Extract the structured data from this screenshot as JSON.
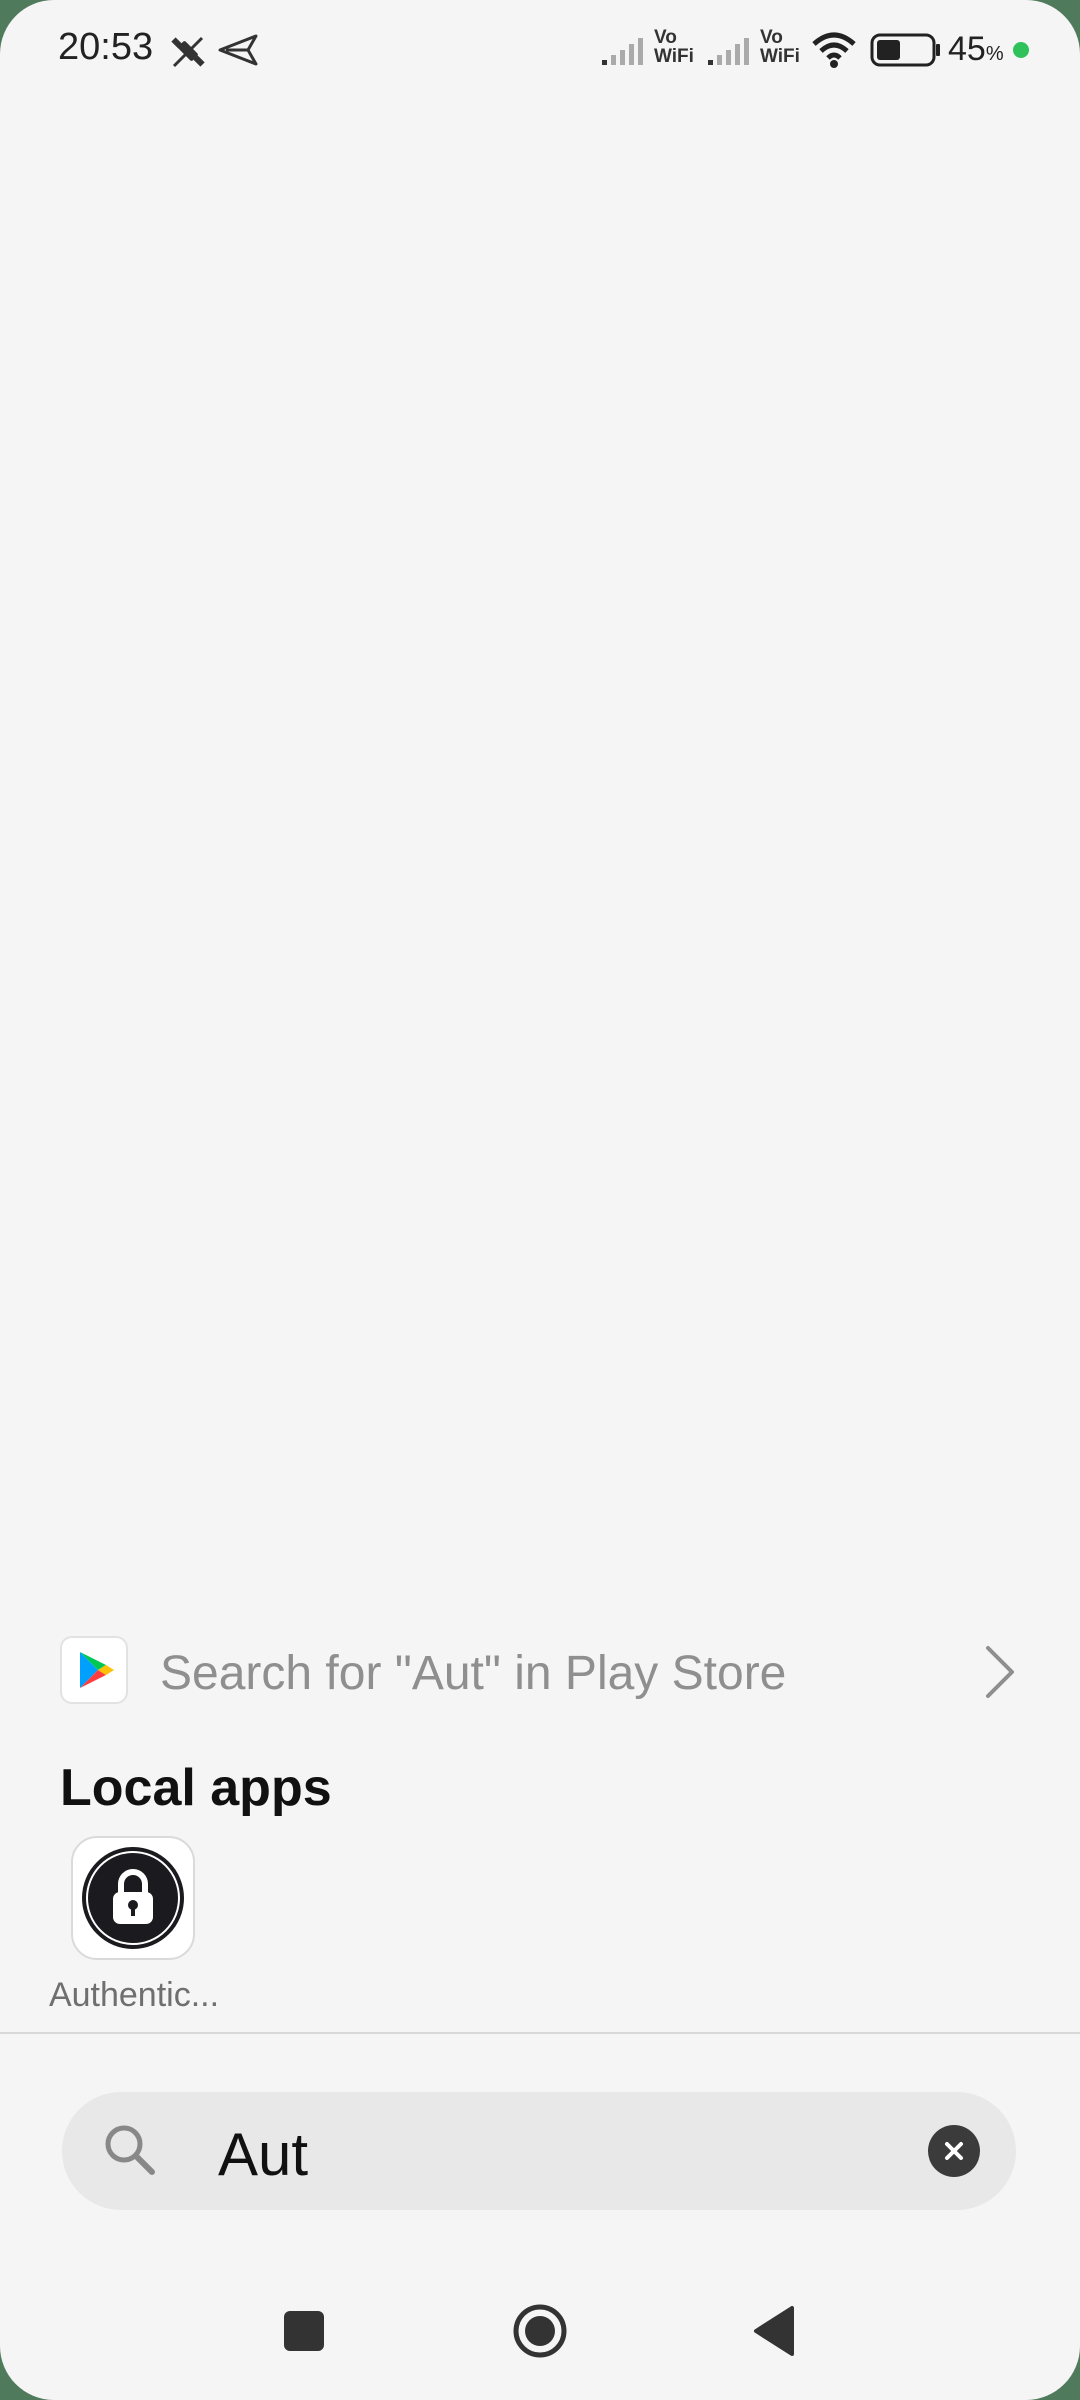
{
  "status_bar": {
    "time": "20:53",
    "icons": [
      "satellite-off-icon",
      "send-icon",
      "signal-icon",
      "vowifi-icon",
      "signal-icon",
      "vowifi-icon",
      "wifi-icon",
      "battery-icon"
    ],
    "vowifi_top": "Vo",
    "vowifi_bottom": "WiFi",
    "battery_value": "45",
    "battery_unit": "%",
    "battery_level": 0.45,
    "dot_color": "#2fc25b"
  },
  "play_store": {
    "label": "Search for \"Aut\" in Play Store"
  },
  "local_apps": {
    "title": "Local apps",
    "items": [
      {
        "label": "Authentic...",
        "icon": "lock-icon"
      }
    ]
  },
  "search": {
    "query": "Aut",
    "icons": [
      "search-icon",
      "clear-icon"
    ]
  },
  "nav_bar": {
    "icons": [
      "recents-icon",
      "home-icon",
      "back-icon"
    ]
  }
}
